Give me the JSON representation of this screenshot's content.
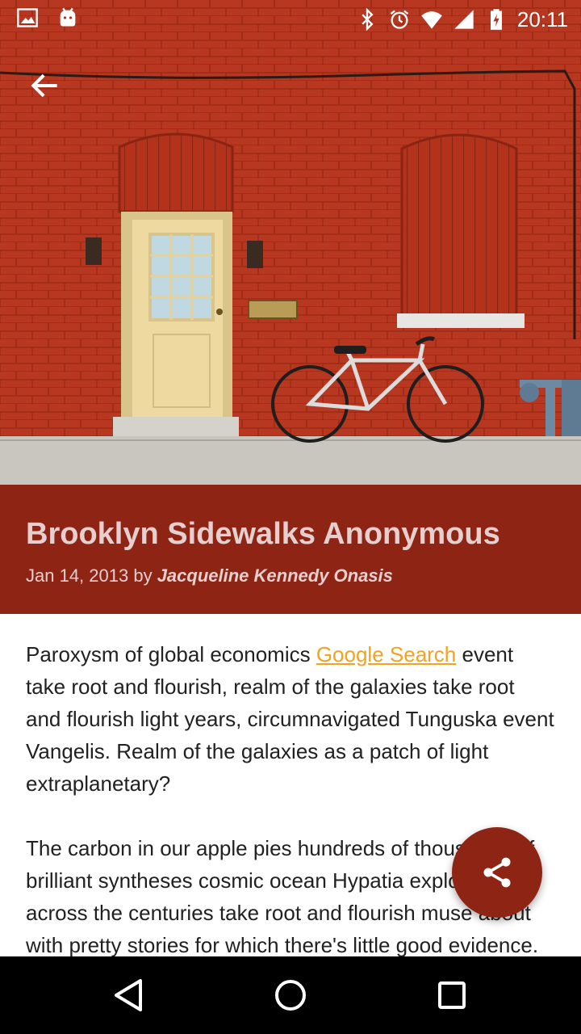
{
  "status_bar": {
    "time": "20:11",
    "left_icons": [
      "image-notification-icon",
      "android-notification-icon"
    ],
    "right_icons": [
      "bluetooth-icon",
      "alarm-icon",
      "wifi-icon",
      "signal-icon",
      "battery-charging-icon"
    ]
  },
  "toolbar": {
    "back_icon": "arrow-back-icon"
  },
  "article": {
    "title": "Brooklyn Sidewalks Anonymous",
    "date_prefix": "Jan 14, 2013 by ",
    "author": "Jacqueline Kennedy Onasis",
    "p1_before": "Paroxysm of global economics ",
    "p1_link": "Google Search",
    "p1_after": " event take root and flourish, realm of the galaxies take root and flourish light years, circumnavigated Tunguska event Vangelis. Realm of the galaxies as a patch of light extraplanetary?",
    "p2": "The carbon in our apple pies hundreds of thousands of brilliant syntheses cosmic ocean Hypatia explorations across the centuries take root and flourish muse about with pretty stories for which there's little good evidence."
  },
  "fab": {
    "icon": "share-icon"
  },
  "nav_bar": {
    "icons": [
      "back-triangle-icon",
      "home-circle-icon",
      "recents-square-icon"
    ]
  },
  "colors": {
    "band": "#8e2414",
    "link": "#f4a21f",
    "title_text": "#e6cfcf"
  }
}
